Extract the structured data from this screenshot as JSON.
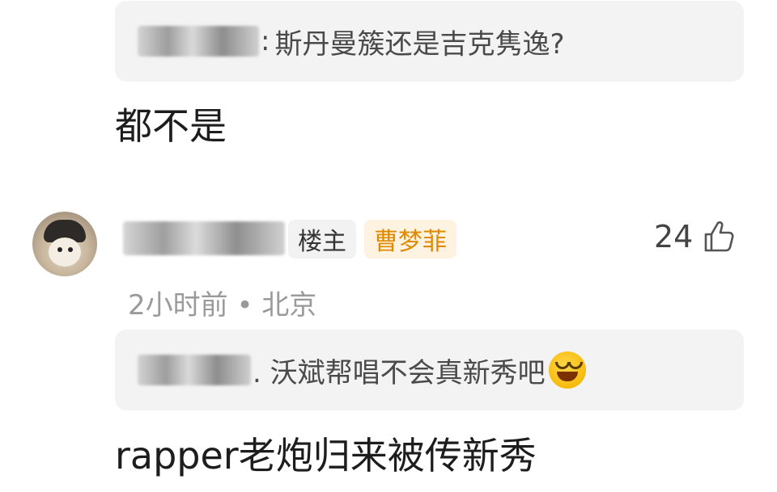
{
  "comment_top": {
    "quote_text": "斯丹曼簇还是吉克隽逸?",
    "reply_text": "都不是"
  },
  "comment_main": {
    "op_badge": "楼主",
    "user_tag": "曹梦菲",
    "like_count": "24",
    "meta": "2小时前 • 北京",
    "quote_text": ". 沃斌帮唱不会真新秀吧",
    "reply_text": "rapper老炮归来被传新秀"
  },
  "icons": {
    "like": "thumbs-up-icon",
    "emoji": "grinning-squinting-face-icon"
  }
}
